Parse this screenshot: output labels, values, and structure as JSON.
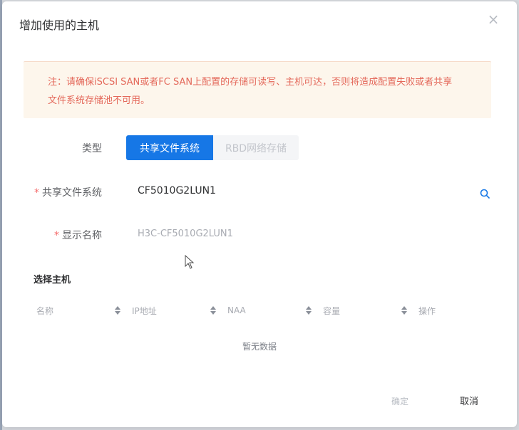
{
  "dialog": {
    "title": "增加使用的主机"
  },
  "notice": {
    "text": "注：请确保iSCSI SAN或者FC SAN上配置的存储可读写、主机可达，否则将造成配置失败或者共享文件系统存储池不可用。"
  },
  "form": {
    "type_label": "类型",
    "type_options": [
      "共享文件系统",
      "RBD网络存储"
    ],
    "fs_label": "共享文件系统",
    "fs_value": "CF5010G2LUN1",
    "display_name_label": "显示名称",
    "display_name_value": "H3C-CF5010G2LUN1",
    "required_mark": "*"
  },
  "hosts": {
    "section_title": "选择主机",
    "columns": [
      "名称",
      "IP地址",
      "NAA",
      "容量",
      "操作"
    ],
    "empty_text": "暂无数据"
  },
  "footer": {
    "ok_label": "确定",
    "cancel_label": "取消"
  },
  "colors": {
    "primary": "#1677e6",
    "notice_text": "#e4685a",
    "notice_bg": "#fdf6ec",
    "required": "#f56c6c"
  }
}
